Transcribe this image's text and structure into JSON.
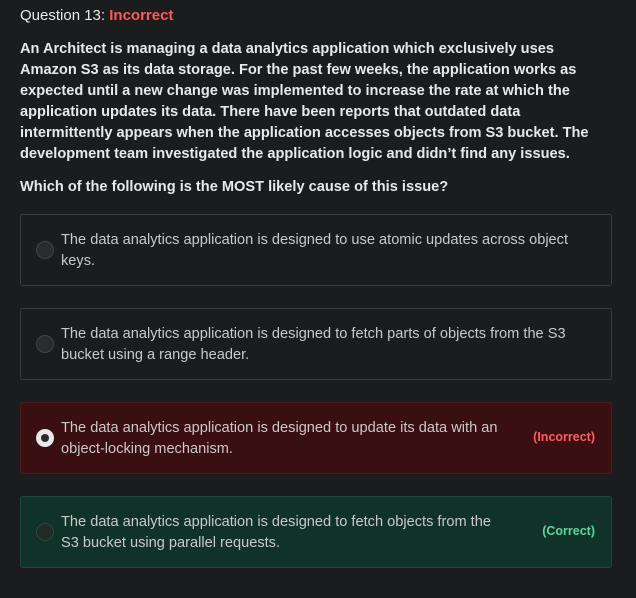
{
  "question": {
    "header_prefix": "Question 13: ",
    "status": "Incorrect",
    "text": "An Architect is managing a data analytics application which exclusively uses Amazon S3 as its data storage. For the past few weeks, the application works as expected until a new change was implemented to increase the rate at which the application updates its data. There have been reports that outdated data intermittently appears when the application accesses objects from S3 bucket. The development team investigated the application logic and didn’t find any issues.",
    "prompt": "Which of the following is the MOST likely cause of this issue?"
  },
  "options": [
    {
      "text": "The data analytics application is designed to use atomic updates across object keys.",
      "state": "unselected"
    },
    {
      "text": "The data analytics application is designed to fetch parts of objects from the S3 bucket using a range header.",
      "state": "unselected"
    },
    {
      "text": "The data analytics application is designed to update its data with an object-locking mechanism.",
      "state": "selected-incorrect",
      "badge": "(Incorrect)"
    },
    {
      "text": "The data analytics application is designed to fetch objects from the S3 bucket using parallel requests.",
      "state": "correct",
      "badge": "(Correct)"
    }
  ],
  "colors": {
    "background": "#1b1c1e",
    "incorrect_bg": "#3a0f11",
    "correct_bg": "#113228",
    "incorrect_text": "#ff5e5e",
    "correct_text": "#5bd6a0"
  }
}
